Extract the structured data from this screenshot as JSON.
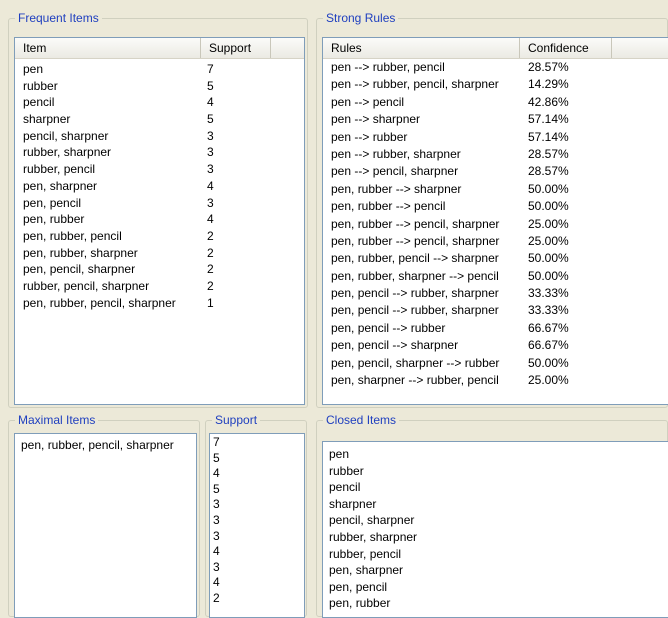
{
  "frequent": {
    "title": "Frequent Items",
    "col_item": "Item",
    "col_support": "Support",
    "rows": [
      {
        "item": "pen",
        "support": "7"
      },
      {
        "item": "rubber",
        "support": "5"
      },
      {
        "item": "pencil",
        "support": "4"
      },
      {
        "item": "sharpner",
        "support": "5"
      },
      {
        "item": "pencil, sharpner",
        "support": "3"
      },
      {
        "item": "rubber, sharpner",
        "support": "3"
      },
      {
        "item": "rubber, pencil",
        "support": "3"
      },
      {
        "item": "pen, sharpner",
        "support": "4"
      },
      {
        "item": "pen, pencil",
        "support": "3"
      },
      {
        "item": "pen, rubber",
        "support": "4"
      },
      {
        "item": "pen, rubber, pencil",
        "support": "2"
      },
      {
        "item": "pen, rubber, sharpner",
        "support": "2"
      },
      {
        "item": "pen, pencil, sharpner",
        "support": "2"
      },
      {
        "item": "rubber, pencil, sharpner",
        "support": "2"
      },
      {
        "item": "pen, rubber, pencil, sharpner",
        "support": "1"
      }
    ]
  },
  "strong": {
    "title": "Strong Rules",
    "col_rules": "Rules",
    "col_confidence": "Confidence",
    "rows": [
      {
        "rule": "pen --> rubber, pencil",
        "conf": "28.57%"
      },
      {
        "rule": "pen --> rubber, pencil, sharpner",
        "conf": "14.29%"
      },
      {
        "rule": "pen --> pencil",
        "conf": "42.86%"
      },
      {
        "rule": "pen --> sharpner",
        "conf": "57.14%"
      },
      {
        "rule": "pen --> rubber",
        "conf": "57.14%"
      },
      {
        "rule": "pen --> rubber, sharpner",
        "conf": "28.57%"
      },
      {
        "rule": "pen --> pencil, sharpner",
        "conf": "28.57%"
      },
      {
        "rule": "pen, rubber --> sharpner",
        "conf": "50.00%"
      },
      {
        "rule": "pen, rubber --> pencil",
        "conf": "50.00%"
      },
      {
        "rule": "pen, rubber --> pencil, sharpner",
        "conf": "25.00%"
      },
      {
        "rule": "pen, rubber --> pencil, sharpner",
        "conf": "25.00%"
      },
      {
        "rule": "pen, rubber, pencil --> sharpner",
        "conf": "50.00%"
      },
      {
        "rule": "pen, rubber, sharpner --> pencil",
        "conf": "50.00%"
      },
      {
        "rule": "pen, pencil --> rubber, sharpner",
        "conf": "33.33%"
      },
      {
        "rule": "pen, pencil --> rubber, sharpner",
        "conf": "33.33%"
      },
      {
        "rule": "pen, pencil --> rubber",
        "conf": "66.67%"
      },
      {
        "rule": "pen, pencil --> sharpner",
        "conf": "66.67%"
      },
      {
        "rule": "pen, pencil, sharpner --> rubber",
        "conf": "50.00%"
      },
      {
        "rule": "pen, sharpner --> rubber, pencil",
        "conf": "25.00%"
      }
    ]
  },
  "maximal": {
    "title": "Maximal Items",
    "items": [
      "pen, rubber, pencil, sharpner"
    ]
  },
  "support": {
    "title": "Support",
    "values": [
      "7",
      "5",
      "4",
      "5",
      "3",
      "3",
      "3",
      "4",
      "3",
      "4",
      "2"
    ]
  },
  "closed": {
    "title": "Closed Items",
    "items": [
      "pen",
      "rubber",
      "pencil",
      "sharpner",
      "pencil, sharpner",
      "rubber, sharpner",
      "rubber, pencil",
      "pen, sharpner",
      "pen, pencil",
      "pen, rubber"
    ]
  }
}
